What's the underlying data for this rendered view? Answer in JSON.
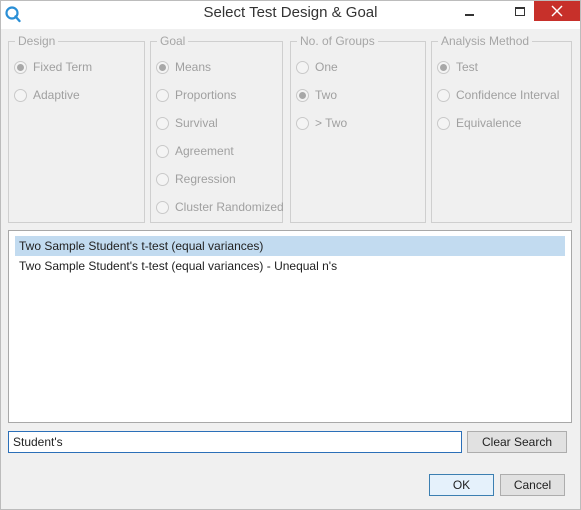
{
  "window": {
    "title": "Select Test Design & Goal",
    "icons": {
      "app": "app-logo-icon",
      "minimize": "minimize-icon",
      "maximize": "maximize-icon",
      "close": "close-icon"
    },
    "close_color": "#c7302a"
  },
  "groups": {
    "design": {
      "legend": "Design",
      "options": [
        {
          "label": "Fixed Term",
          "checked": true
        },
        {
          "label": "Adaptive",
          "checked": false
        }
      ]
    },
    "goal": {
      "legend": "Goal",
      "options": [
        {
          "label": "Means",
          "checked": true
        },
        {
          "label": "Proportions",
          "checked": false
        },
        {
          "label": "Survival",
          "checked": false
        },
        {
          "label": "Agreement",
          "checked": false
        },
        {
          "label": "Regression",
          "checked": false
        },
        {
          "label": "Cluster Randomized",
          "checked": false
        }
      ]
    },
    "groups_count": {
      "legend": "No. of Groups",
      "options": [
        {
          "label": "One",
          "checked": false
        },
        {
          "label": "Two",
          "checked": true
        },
        {
          "label": "> Two",
          "checked": false
        }
      ]
    },
    "analysis": {
      "legend": "Analysis Method",
      "options": [
        {
          "label": "Test",
          "checked": true
        },
        {
          "label": "Confidence Interval",
          "checked": false
        },
        {
          "label": "Equivalence",
          "checked": false
        }
      ]
    }
  },
  "results": {
    "items": [
      {
        "label": "Two Sample Student's t-test (equal variances)",
        "selected": true
      },
      {
        "label": "Two Sample Student's t-test (equal variances) - Unequal n's",
        "selected": false
      }
    ],
    "selected_color": "#c2dbf0"
  },
  "search": {
    "value": "Student's",
    "clear_label": "Clear Search"
  },
  "footer": {
    "ok_label": "OK",
    "cancel_label": "Cancel"
  }
}
